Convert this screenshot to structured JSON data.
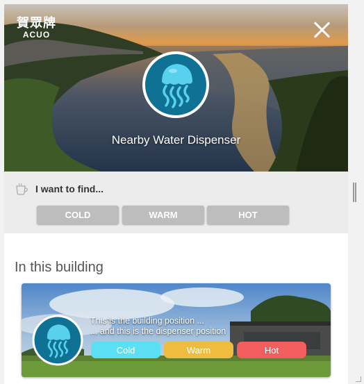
{
  "brand": {
    "name_cn": "賀眾牌",
    "name_en": "ACUO"
  },
  "hero": {
    "title": "Nearby Water Dispenser",
    "logo_icon": "jellyfish-icon"
  },
  "find": {
    "label": "I want to find...",
    "icon": "cup-icon",
    "options": [
      "COLD",
      "WARM",
      "HOT"
    ]
  },
  "section": {
    "title": "In this building"
  },
  "card": {
    "line1": "This is the building position ...",
    "line2": "... and this is the dispenser position",
    "logo_icon": "jellyfish-icon",
    "tags": [
      {
        "label": "Cold",
        "color": "#5be0f3"
      },
      {
        "label": "Warm",
        "color": "#eebd3f"
      },
      {
        "label": "Hot",
        "color": "#f25e5e"
      }
    ]
  },
  "colors": {
    "logo_bg": "#0f7193",
    "button_gray": "#bdbdbd",
    "find_bg": "#ececec"
  }
}
